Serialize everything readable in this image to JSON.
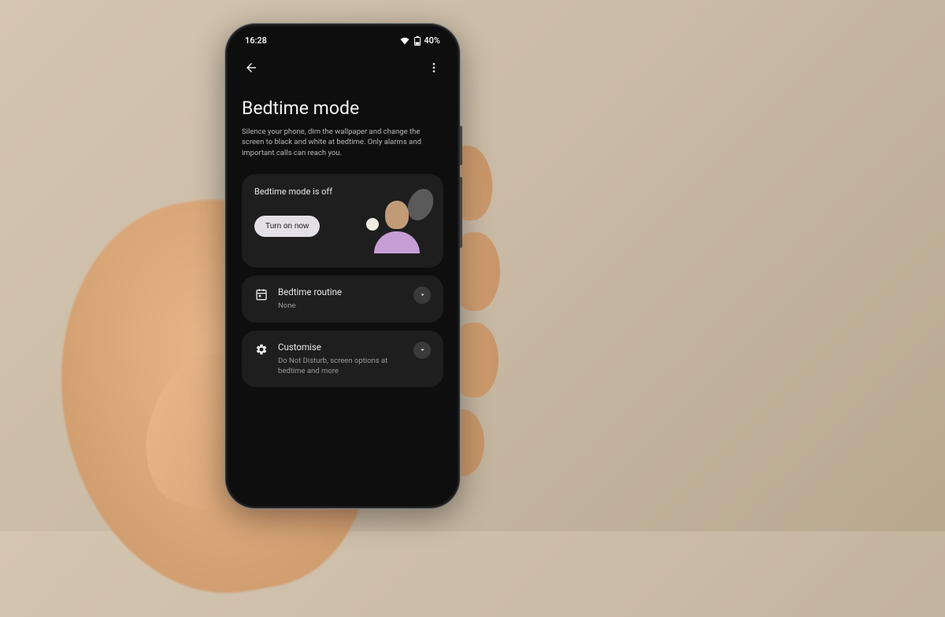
{
  "status_bar": {
    "time": "16:28",
    "battery_text": "40%"
  },
  "header": {
    "title": "Bedtime mode",
    "description": "Silence your phone, dim the wallpaper and change the screen to black and white at bedtime. Only alarms and important calls can reach you."
  },
  "status_card": {
    "status_text": "Bedtime mode is off",
    "button_label": "Turn on now"
  },
  "routine_card": {
    "title": "Bedtime routine",
    "subtitle": "None"
  },
  "customise_card": {
    "title": "Customise",
    "subtitle": "Do Not Disturb, screen options at bedtime and more"
  }
}
